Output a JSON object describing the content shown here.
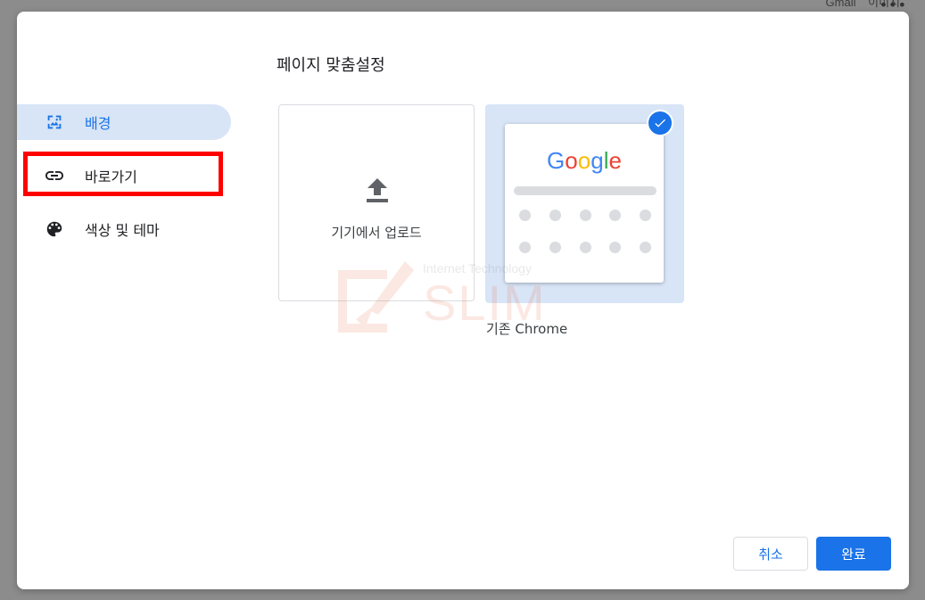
{
  "background_page": {
    "top_links": [
      "Gmail",
      "이미지"
    ],
    "more_icon": "more-horiz-icon"
  },
  "dialog": {
    "title": "페이지 맞춤설정",
    "sidebar": {
      "items": [
        {
          "label": "배경",
          "icon": "wallpaper-icon",
          "active": true
        },
        {
          "label": "바로가기",
          "icon": "link-icon",
          "active": false
        },
        {
          "label": "색상 및 테마",
          "icon": "palette-icon",
          "active": false
        }
      ]
    },
    "tiles": {
      "upload": {
        "label": "기기에서 업로드",
        "icon": "upload-icon"
      },
      "default": {
        "label": "기존 Chrome",
        "logo_text": "Google",
        "selected": true,
        "check_icon": "check-circle-icon"
      }
    },
    "watermark": {
      "small": "Internet Technology",
      "big": "SLIM"
    },
    "buttons": {
      "cancel": "취소",
      "done": "완료"
    }
  },
  "colors": {
    "accent": "#1a73e8",
    "active_bg": "#d8e5f7",
    "highlight": "#ff0000",
    "google_blue": "#4285f4",
    "google_red": "#ea4335",
    "google_yellow": "#fbbc05",
    "google_green": "#34a853"
  }
}
